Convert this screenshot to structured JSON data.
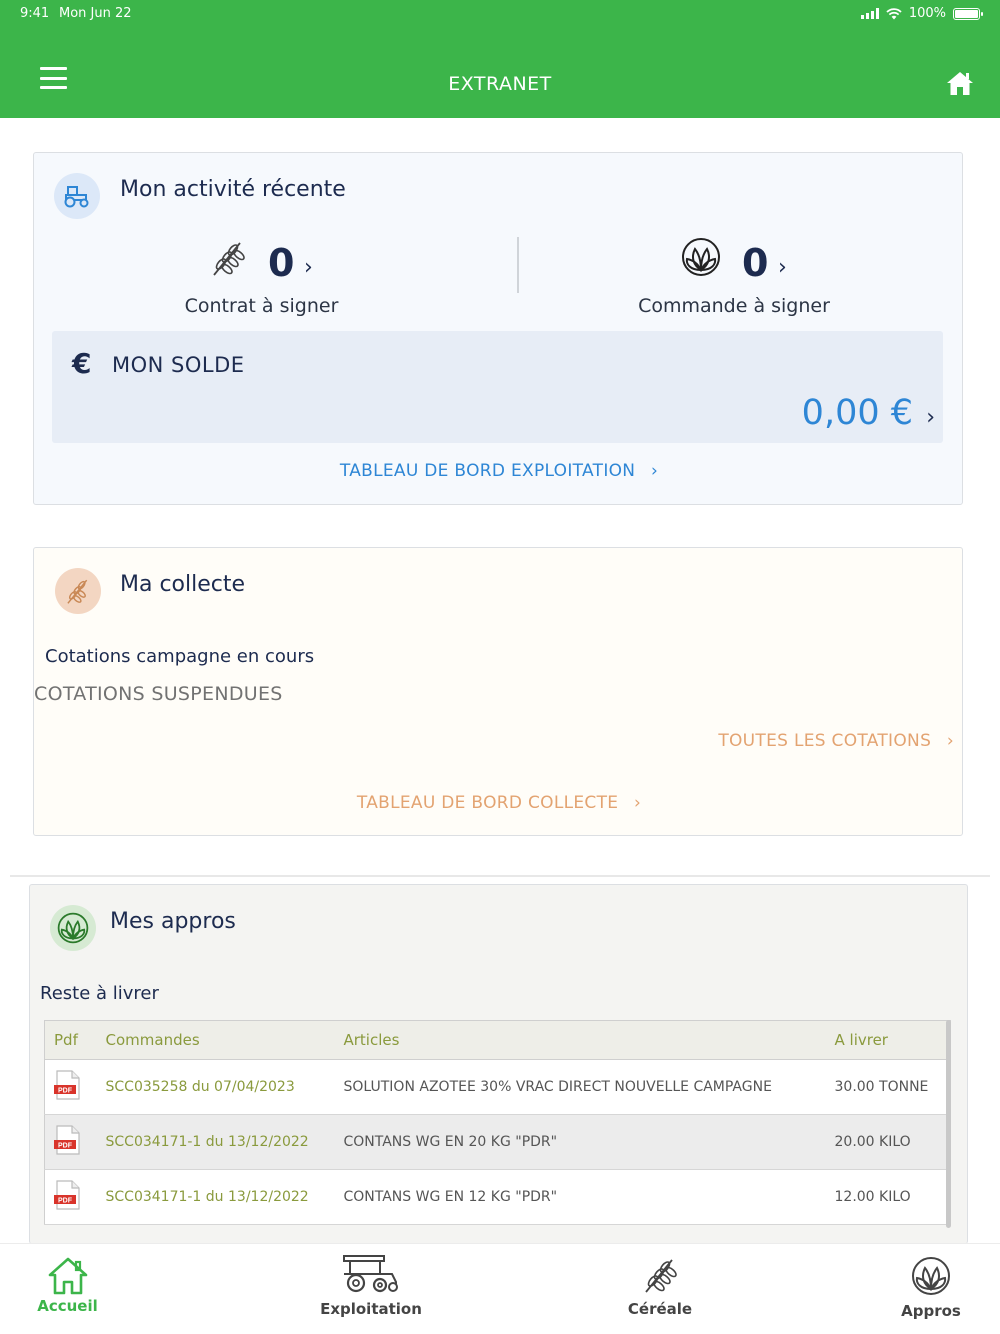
{
  "status_bar": {
    "time": "9:41",
    "date": "Mon Jun 22",
    "battery": "100%"
  },
  "header": {
    "title": "EXTRANET"
  },
  "activity": {
    "title": "Mon activité récente",
    "contract_count": "0",
    "contract_label": "Contrat à signer",
    "order_count": "0",
    "order_label": "Commande à signer",
    "solde_label": "MON SOLDE",
    "solde_currency": "€",
    "solde_amount": "0,00 €",
    "dashboard_link": "TABLEAU DE BORD EXPLOITATION"
  },
  "collecte": {
    "title": "Ma collecte",
    "subtitle": "Cotations campagne en cours",
    "status": "COTATIONS SUSPENDUES",
    "all_link": "TOUTES LES COTATIONS",
    "dashboard_link": "TABLEAU DE BORD COLLECTE"
  },
  "appros": {
    "title": "Mes appros",
    "subtitle": "Reste à livrer",
    "columns": [
      "Pdf",
      "Commandes",
      "Articles",
      "A livrer"
    ],
    "rows": [
      {
        "commande": "SCC035258 du 07/04/2023",
        "article": "SOLUTION AZOTEE 30% VRAC DIRECT NOUVELLE CAMPAGNE",
        "a_livrer": "30.00 TONNE"
      },
      {
        "commande": "SCC034171-1 du 13/12/2022",
        "article": "CONTANS WG EN 20 KG \"PDR\"",
        "a_livrer": "20.00 KILO"
      },
      {
        "commande": "SCC034171-1 du 13/12/2022",
        "article": "CONTANS WG EN 12 KG \"PDR\"",
        "a_livrer": "12.00 KILO"
      }
    ]
  },
  "bottom_nav": [
    {
      "label": "Accueil",
      "icon": "home-icon",
      "active": true
    },
    {
      "label": "Exploitation",
      "icon": "tractor-icon"
    },
    {
      "label": "Céréale",
      "icon": "wheat-icon"
    },
    {
      "label": "Appros",
      "icon": "leaf-circle-icon"
    }
  ],
  "colors": {
    "brand_green": "#3cb54a",
    "link_blue": "#2e86d5",
    "link_orange": "#e3a371",
    "navy": "#1d2b4f"
  }
}
